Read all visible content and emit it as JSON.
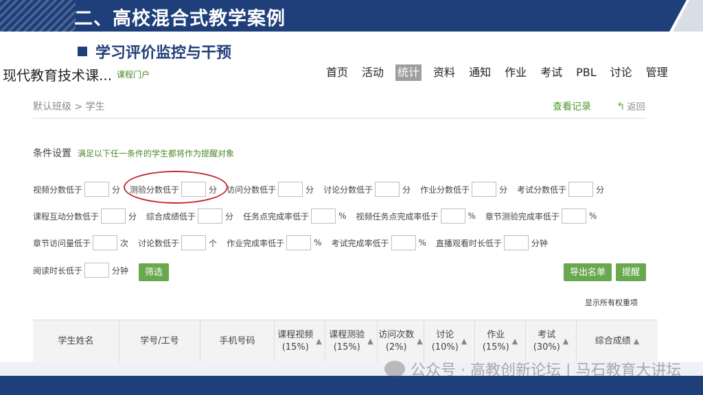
{
  "slide": {
    "title": "二、高校混合式教学案例",
    "subtitle": "学习评价监控与干预"
  },
  "course": {
    "title": "现代教育技术课...",
    "portal": "课程门户"
  },
  "nav": [
    "首页",
    "活动",
    "统计",
    "资料",
    "通知",
    "作业",
    "考试",
    "PBL",
    "讨论",
    "管理"
  ],
  "nav_active": "统计",
  "breadcrumb": "默认班级 > 学生",
  "view_records": "查看记录",
  "back": "返回",
  "conditions": {
    "title": "条件设置",
    "hint": "满足以下任一条件的学生都将作为提醒对象"
  },
  "filters": {
    "row1": [
      {
        "label": "视频分数低于",
        "unit": "分"
      },
      {
        "label": "测验分数低于",
        "unit": "分"
      },
      {
        "label": "访问分数低于",
        "unit": "分"
      },
      {
        "label": "讨论分数低于",
        "unit": "分"
      },
      {
        "label": "作业分数低于",
        "unit": "分"
      },
      {
        "label": "考试分数低于",
        "unit": "分"
      }
    ],
    "row2": [
      {
        "label": "课程互动分数低于",
        "unit": "分"
      },
      {
        "label": "综合成绩低于",
        "unit": "分"
      },
      {
        "label": "任务点完成率低于",
        "unit": "%"
      },
      {
        "label": "视频任务点完成率低于",
        "unit": "%"
      },
      {
        "label": "章节测验完成率低于",
        "unit": "%"
      }
    ],
    "row3": [
      {
        "label": "章节访问量低于",
        "unit": "次"
      },
      {
        "label": "讨论数低于",
        "unit": "个"
      },
      {
        "label": "作业完成率低于",
        "unit": "%"
      },
      {
        "label": "考试完成率低于",
        "unit": "%"
      },
      {
        "label": "直播观看时长低于",
        "unit": "分钟"
      }
    ],
    "row4": [
      {
        "label": "阅读时长低于",
        "unit": "分钟"
      }
    ]
  },
  "buttons": {
    "filter": "筛选",
    "export": "导出名单",
    "remind": "提醒"
  },
  "show_all_weights": "显示所有权重项",
  "table": {
    "headers": [
      {
        "line1": "学生姓名",
        "line2": "",
        "sortable": false
      },
      {
        "line1": "学号/工号",
        "line2": "",
        "sortable": false
      },
      {
        "line1": "手机号码",
        "line2": "",
        "sortable": false
      },
      {
        "line1": "课程视频",
        "line2": "(15%)",
        "sortable": true
      },
      {
        "line1": "课程测验",
        "line2": "(15%)",
        "sortable": true
      },
      {
        "line1": "访问次数",
        "line2": "(2%)",
        "sortable": true
      },
      {
        "line1": "讨论",
        "line2": "(10%)",
        "sortable": true
      },
      {
        "line1": "作业",
        "line2": "(15%)",
        "sortable": true
      },
      {
        "line1": "考试",
        "line2": "(30%)",
        "sortable": true
      },
      {
        "line1": "综合成绩",
        "line2": "",
        "sortable": true
      }
    ]
  },
  "watermark": "公众号 · 高教创新论坛 | 马石教育大讲坛",
  "colors": {
    "brand_blue": "#1f3f7a",
    "accent_green": "#6aa84f",
    "highlight_red": "#c0282c"
  }
}
